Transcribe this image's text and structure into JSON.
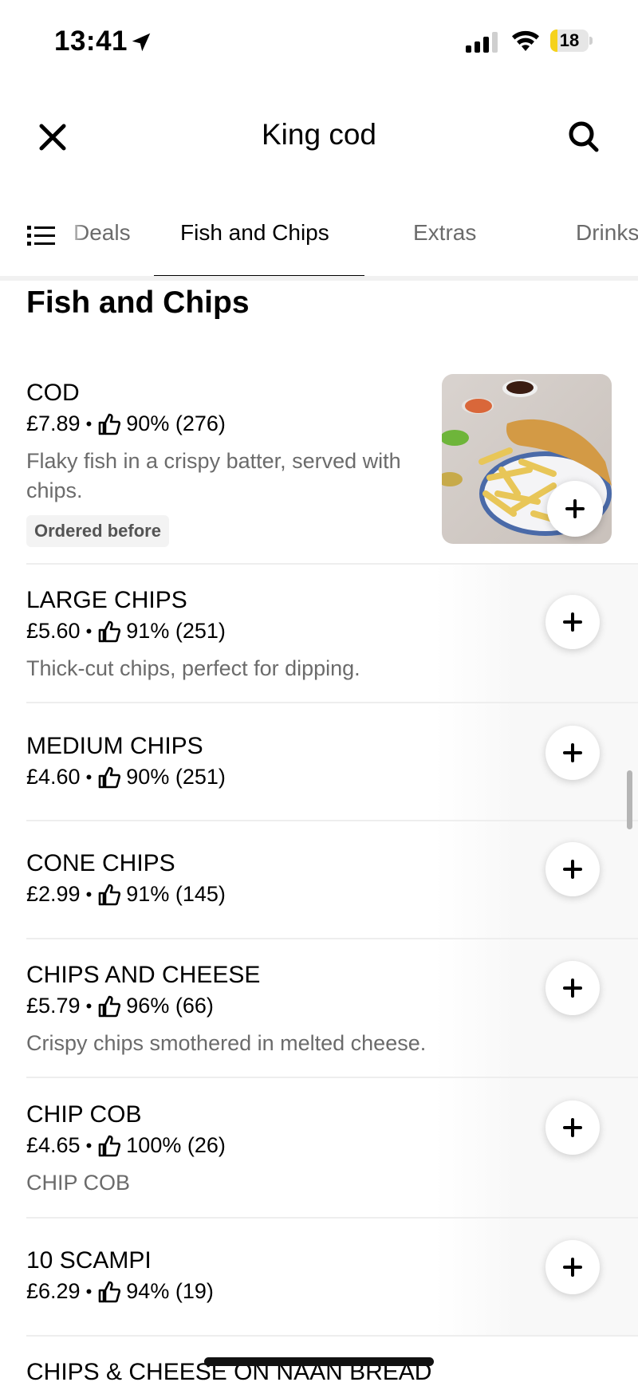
{
  "status_bar": {
    "time": "13:41",
    "battery": "18",
    "battery_level": 0.18,
    "icons": [
      "location-arrow-icon",
      "signal-icon",
      "wifi-icon",
      "battery-icon"
    ]
  },
  "header": {
    "title": "King cod",
    "close_icon": "close-icon",
    "search_icon": "search-icon"
  },
  "tabs": {
    "menu_icon": "menu-list-icon",
    "items": [
      {
        "label": "Deals",
        "active": false
      },
      {
        "label": "Fish and Chips",
        "active": true
      },
      {
        "label": "Extras",
        "active": false
      },
      {
        "label": "Drinks",
        "active": false
      }
    ]
  },
  "section": {
    "title": "Fish and Chips"
  },
  "items": [
    {
      "name": "COD",
      "price": "£7.89",
      "rating": "90% (276)",
      "description": "Flaky fish in a crispy batter, served with chips.",
      "badge": "Ordered before",
      "has_image": true
    },
    {
      "name": "LARGE CHIPS",
      "price": "£5.60",
      "rating": "91% (251)",
      "description": "Thick-cut chips, perfect for dipping."
    },
    {
      "name": "MEDIUM CHIPS",
      "price": "£4.60",
      "rating": "90% (251)",
      "description": ""
    },
    {
      "name": "CONE CHIPS",
      "price": "£2.99",
      "rating": "91% (145)",
      "description": ""
    },
    {
      "name": "CHIPS AND CHEESE",
      "price": "£5.79",
      "rating": "96% (66)",
      "description": "Crispy chips smothered in melted cheese."
    },
    {
      "name": "CHIP COB",
      "price": "£4.65",
      "rating": "100% (26)",
      "description": "CHIP COB"
    },
    {
      "name": "10 SCAMPI",
      "price": "£6.29",
      "rating": "94% (19)",
      "description": ""
    },
    {
      "name": "CHIPS & CHEESE ON NAAN BREAD",
      "price": "",
      "rating": "",
      "description": ""
    }
  ],
  "separator": "•"
}
